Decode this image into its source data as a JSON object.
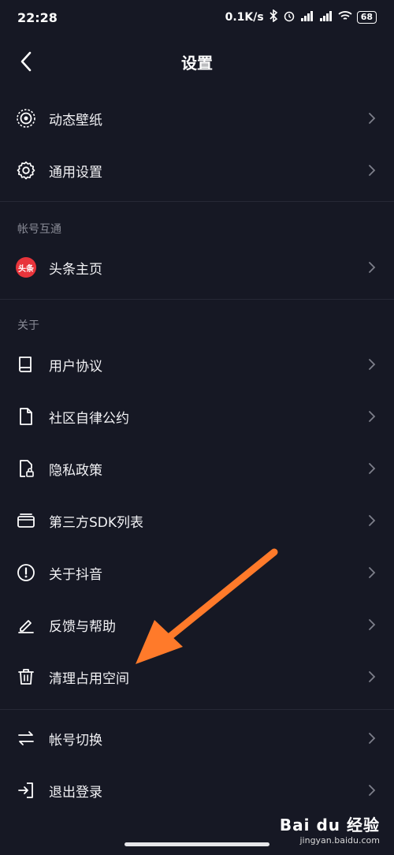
{
  "status_bar": {
    "time": "22:28",
    "network_speed": "0.1K/s",
    "battery": "68",
    "icons": [
      "bluetooth-icon",
      "alarm-icon",
      "signal-icon",
      "signal-hd-icon",
      "wifi-icon",
      "battery-icon"
    ]
  },
  "header": {
    "title": "设置"
  },
  "items": {
    "wallpaper": "动态壁纸",
    "general": "通用设置",
    "toutiao": "头条主页",
    "user_agreement": "用户协议",
    "community": "社区自律公约",
    "privacy": "隐私政策",
    "sdk_list": "第三方SDK列表",
    "about": "关于抖音",
    "feedback": "反馈与帮助",
    "clear_cache": "清理占用空间",
    "switch_account": "帐号切换",
    "logout": "退出登录"
  },
  "sections": {
    "account_link": "帐号互通",
    "about": "关于"
  },
  "toutiao_logo_text": "头条",
  "watermark": {
    "brand": "Bai du 经验",
    "url": "jingyan.baidu.com"
  },
  "colors": {
    "background": "#161824",
    "annotation_arrow": "#ff7a2a",
    "toutiao_red": "#e8343b"
  }
}
